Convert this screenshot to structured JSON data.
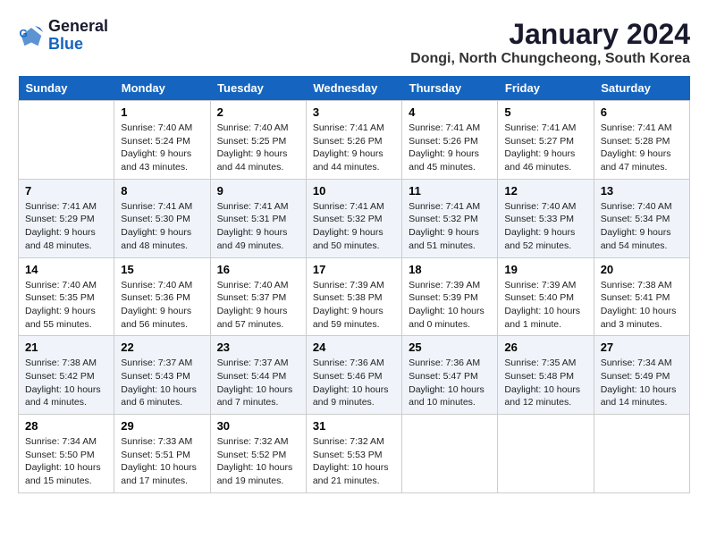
{
  "logo": {
    "line1": "General",
    "line2": "Blue"
  },
  "title": "January 2024",
  "subtitle": "Dongi, North Chungcheong, South Korea",
  "headers": [
    "Sunday",
    "Monday",
    "Tuesday",
    "Wednesday",
    "Thursday",
    "Friday",
    "Saturday"
  ],
  "weeks": [
    [
      {
        "num": "",
        "info": ""
      },
      {
        "num": "1",
        "info": "Sunrise: 7:40 AM\nSunset: 5:24 PM\nDaylight: 9 hours\nand 43 minutes."
      },
      {
        "num": "2",
        "info": "Sunrise: 7:40 AM\nSunset: 5:25 PM\nDaylight: 9 hours\nand 44 minutes."
      },
      {
        "num": "3",
        "info": "Sunrise: 7:41 AM\nSunset: 5:26 PM\nDaylight: 9 hours\nand 44 minutes."
      },
      {
        "num": "4",
        "info": "Sunrise: 7:41 AM\nSunset: 5:26 PM\nDaylight: 9 hours\nand 45 minutes."
      },
      {
        "num": "5",
        "info": "Sunrise: 7:41 AM\nSunset: 5:27 PM\nDaylight: 9 hours\nand 46 minutes."
      },
      {
        "num": "6",
        "info": "Sunrise: 7:41 AM\nSunset: 5:28 PM\nDaylight: 9 hours\nand 47 minutes."
      }
    ],
    [
      {
        "num": "7",
        "info": "Sunrise: 7:41 AM\nSunset: 5:29 PM\nDaylight: 9 hours\nand 48 minutes."
      },
      {
        "num": "8",
        "info": "Sunrise: 7:41 AM\nSunset: 5:30 PM\nDaylight: 9 hours\nand 48 minutes."
      },
      {
        "num": "9",
        "info": "Sunrise: 7:41 AM\nSunset: 5:31 PM\nDaylight: 9 hours\nand 49 minutes."
      },
      {
        "num": "10",
        "info": "Sunrise: 7:41 AM\nSunset: 5:32 PM\nDaylight: 9 hours\nand 50 minutes."
      },
      {
        "num": "11",
        "info": "Sunrise: 7:41 AM\nSunset: 5:32 PM\nDaylight: 9 hours\nand 51 minutes."
      },
      {
        "num": "12",
        "info": "Sunrise: 7:40 AM\nSunset: 5:33 PM\nDaylight: 9 hours\nand 52 minutes."
      },
      {
        "num": "13",
        "info": "Sunrise: 7:40 AM\nSunset: 5:34 PM\nDaylight: 9 hours\nand 54 minutes."
      }
    ],
    [
      {
        "num": "14",
        "info": "Sunrise: 7:40 AM\nSunset: 5:35 PM\nDaylight: 9 hours\nand 55 minutes."
      },
      {
        "num": "15",
        "info": "Sunrise: 7:40 AM\nSunset: 5:36 PM\nDaylight: 9 hours\nand 56 minutes."
      },
      {
        "num": "16",
        "info": "Sunrise: 7:40 AM\nSunset: 5:37 PM\nDaylight: 9 hours\nand 57 minutes."
      },
      {
        "num": "17",
        "info": "Sunrise: 7:39 AM\nSunset: 5:38 PM\nDaylight: 9 hours\nand 59 minutes."
      },
      {
        "num": "18",
        "info": "Sunrise: 7:39 AM\nSunset: 5:39 PM\nDaylight: 10 hours\nand 0 minutes."
      },
      {
        "num": "19",
        "info": "Sunrise: 7:39 AM\nSunset: 5:40 PM\nDaylight: 10 hours\nand 1 minute."
      },
      {
        "num": "20",
        "info": "Sunrise: 7:38 AM\nSunset: 5:41 PM\nDaylight: 10 hours\nand 3 minutes."
      }
    ],
    [
      {
        "num": "21",
        "info": "Sunrise: 7:38 AM\nSunset: 5:42 PM\nDaylight: 10 hours\nand 4 minutes."
      },
      {
        "num": "22",
        "info": "Sunrise: 7:37 AM\nSunset: 5:43 PM\nDaylight: 10 hours\nand 6 minutes."
      },
      {
        "num": "23",
        "info": "Sunrise: 7:37 AM\nSunset: 5:44 PM\nDaylight: 10 hours\nand 7 minutes."
      },
      {
        "num": "24",
        "info": "Sunrise: 7:36 AM\nSunset: 5:46 PM\nDaylight: 10 hours\nand 9 minutes."
      },
      {
        "num": "25",
        "info": "Sunrise: 7:36 AM\nSunset: 5:47 PM\nDaylight: 10 hours\nand 10 minutes."
      },
      {
        "num": "26",
        "info": "Sunrise: 7:35 AM\nSunset: 5:48 PM\nDaylight: 10 hours\nand 12 minutes."
      },
      {
        "num": "27",
        "info": "Sunrise: 7:34 AM\nSunset: 5:49 PM\nDaylight: 10 hours\nand 14 minutes."
      }
    ],
    [
      {
        "num": "28",
        "info": "Sunrise: 7:34 AM\nSunset: 5:50 PM\nDaylight: 10 hours\nand 15 minutes."
      },
      {
        "num": "29",
        "info": "Sunrise: 7:33 AM\nSunset: 5:51 PM\nDaylight: 10 hours\nand 17 minutes."
      },
      {
        "num": "30",
        "info": "Sunrise: 7:32 AM\nSunset: 5:52 PM\nDaylight: 10 hours\nand 19 minutes."
      },
      {
        "num": "31",
        "info": "Sunrise: 7:32 AM\nSunset: 5:53 PM\nDaylight: 10 hours\nand 21 minutes."
      },
      {
        "num": "",
        "info": ""
      },
      {
        "num": "",
        "info": ""
      },
      {
        "num": "",
        "info": ""
      }
    ]
  ]
}
